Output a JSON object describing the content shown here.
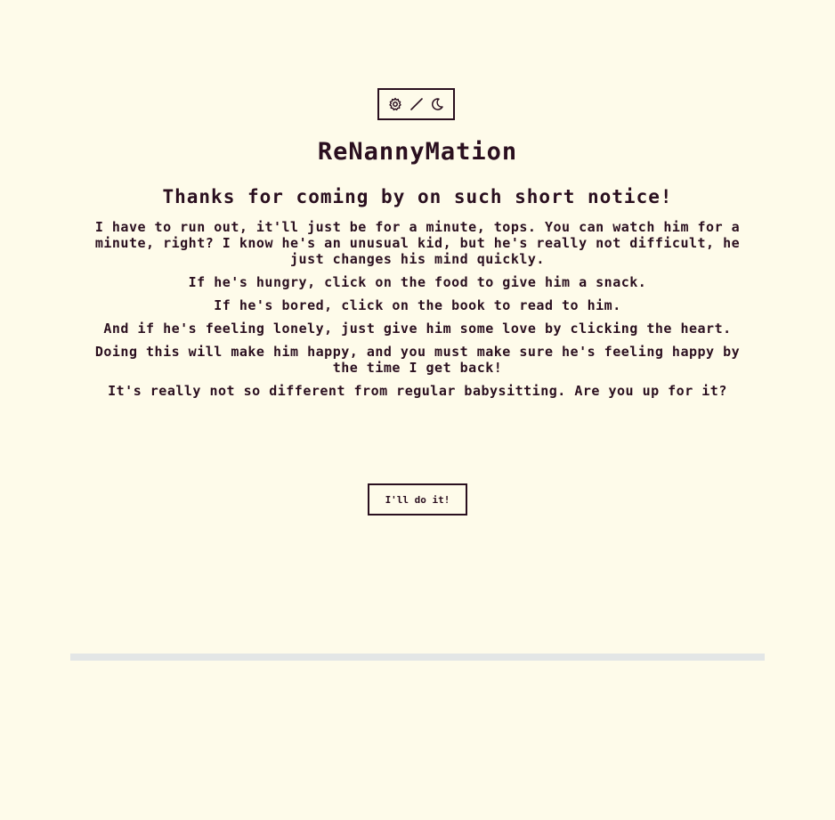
{
  "toolbar": {
    "icons": [
      "gear-icon",
      "brush-icon",
      "moon-icon"
    ]
  },
  "app": {
    "title": "ReNannyMation"
  },
  "intro": {
    "heading": "Thanks for coming by on such short notice!",
    "paragraphs": [
      "I have to run out, it'll just be for a minute, tops. You can watch him for a minute, right? I know he's an unusual kid, but he's really not difficult, he just changes his mind quickly.",
      "If he's hungry, click on the food to give him a snack.",
      "If he's bored, click on the book to read to him.",
      "And if he's feeling lonely, just give him some love by clicking the heart.",
      "Doing this will make him happy, and you must make sure he's feeling happy by the time I get back!",
      "It's really not so different from regular babysitting. Are you up for it?"
    ],
    "start_label": "I'll do it!"
  },
  "colors": {
    "background": "#fefbea",
    "ink": "#2a0f1f",
    "divider": "#e3e6e6"
  }
}
